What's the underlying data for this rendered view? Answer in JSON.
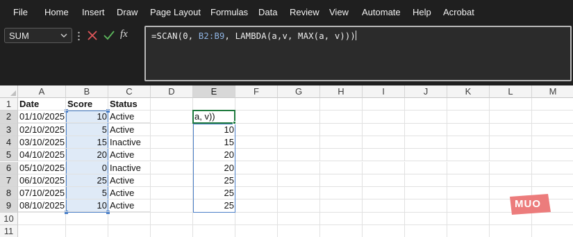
{
  "menu": [
    "File",
    "Home",
    "Insert",
    "Draw",
    "Page Layout",
    "Formulas",
    "Data",
    "Review",
    "View",
    "Automate",
    "Help",
    "Acrobat"
  ],
  "formula_bar": {
    "name_box": "SUM",
    "fx_label": "fx",
    "formula_parts": [
      "=SCAN(0, ",
      "B2:B9",
      ", LAMBDA(a,v, MAX(a, v)))"
    ]
  },
  "columns": [
    "A",
    "B",
    "C",
    "D",
    "E",
    "F",
    "G",
    "H",
    "I",
    "J",
    "K",
    "L",
    "M"
  ],
  "rows": [
    "1",
    "2",
    "3",
    "4",
    "5",
    "6",
    "7",
    "8",
    "9",
    "10",
    "11"
  ],
  "headers": {
    "date": "Date",
    "score": "Score",
    "status": "Status"
  },
  "data_rows": [
    {
      "date": "01/10/2025",
      "score": "10",
      "status": "Active"
    },
    {
      "date": "02/10/2025",
      "score": "5",
      "status": "Active"
    },
    {
      "date": "03/10/2025",
      "score": "15",
      "status": "Inactive"
    },
    {
      "date": "04/10/2025",
      "score": "20",
      "status": "Active"
    },
    {
      "date": "05/10/2025",
      "score": "0",
      "status": "Inactive"
    },
    {
      "date": "06/10/2025",
      "score": "25",
      "status": "Active"
    },
    {
      "date": "07/10/2025",
      "score": "5",
      "status": "Active"
    },
    {
      "date": "08/10/2025",
      "score": "10",
      "status": "Active"
    }
  ],
  "column_e": {
    "editing_text": "a, v))",
    "values": [
      "10",
      "15",
      "20",
      "20",
      "25",
      "25",
      "25"
    ]
  },
  "colors": {
    "menu_bg": "#1f1f1f",
    "range_border": "#4a7fc8",
    "range_fill": "#c5d9f1",
    "active_border": "#1f7a3e",
    "cancel": "#e0575b",
    "enter": "#5cb85c",
    "logo": "#ec7c7c"
  },
  "logo": {
    "text": "MUO"
  }
}
